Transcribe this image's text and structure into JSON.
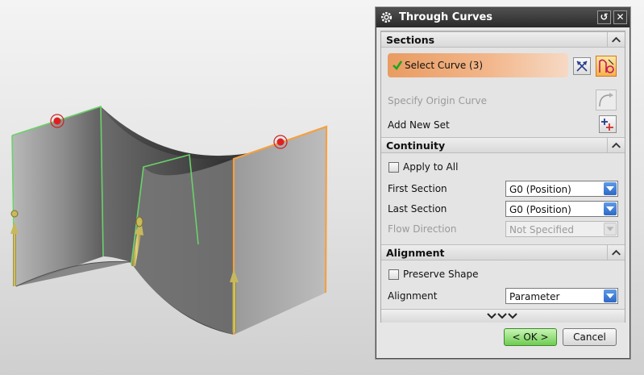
{
  "dialog": {
    "title": "Through Curves",
    "buttons": {
      "reset_symbol": "↺",
      "close_symbol": "✕"
    }
  },
  "sections": {
    "header": "Sections",
    "select_curve_label": "Select Curve (3)",
    "specify_origin_label": "Specify Origin Curve",
    "add_new_set_label": "Add New Set"
  },
  "continuity": {
    "header": "Continuity",
    "apply_to_all_label": "Apply to All",
    "first_section_label": "First Section",
    "first_section_value": "G0 (Position)",
    "last_section_label": "Last Section",
    "last_section_value": "G0 (Position)",
    "flow_direction_label": "Flow Direction",
    "flow_direction_value": "Not Specified"
  },
  "alignment": {
    "header": "Alignment",
    "preserve_shape_label": "Preserve Shape",
    "alignment_label": "Alignment",
    "alignment_value": "Parameter"
  },
  "footer": {
    "ok_label": "< OK >",
    "cancel_label": "Cancel"
  },
  "colors": {
    "surface": "#6a6a6a",
    "section_curve_green": "#6ad26a",
    "section_curve_orange": "#f5a040",
    "vector_arrow": "#b2a24a",
    "point_marker": "#d51c1c",
    "selection_highlight": "#e99c62"
  }
}
